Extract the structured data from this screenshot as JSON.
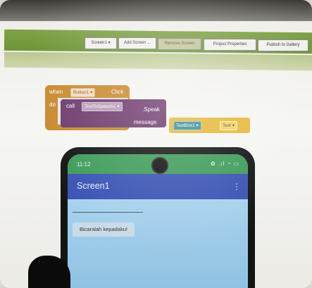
{
  "monitor": {
    "toolbar_buttons": [
      "Screen1 ▾",
      "Add Screen ...",
      "Remove Screen",
      "Project Properties",
      "Publish to Gallery"
    ]
  },
  "blocks": {
    "when_label": "when",
    "button_slot": "Button1 ▾",
    "click_label": "Click",
    "do_label": "do",
    "call_label": "call",
    "tts_slot": "TextToSpeech1 ▾",
    "speak_label": ".Speak",
    "message_label": "message",
    "textbox_slot": "TextBox1 ▾",
    "text_slot": "Text ▾"
  },
  "phone": {
    "time": "11:12",
    "status_icons": "✿ .ıl ◔ ▭",
    "screen_title": "Screen1",
    "menu_icon": "⋮",
    "button_label": "Bicaralah kepadaku!"
  }
}
